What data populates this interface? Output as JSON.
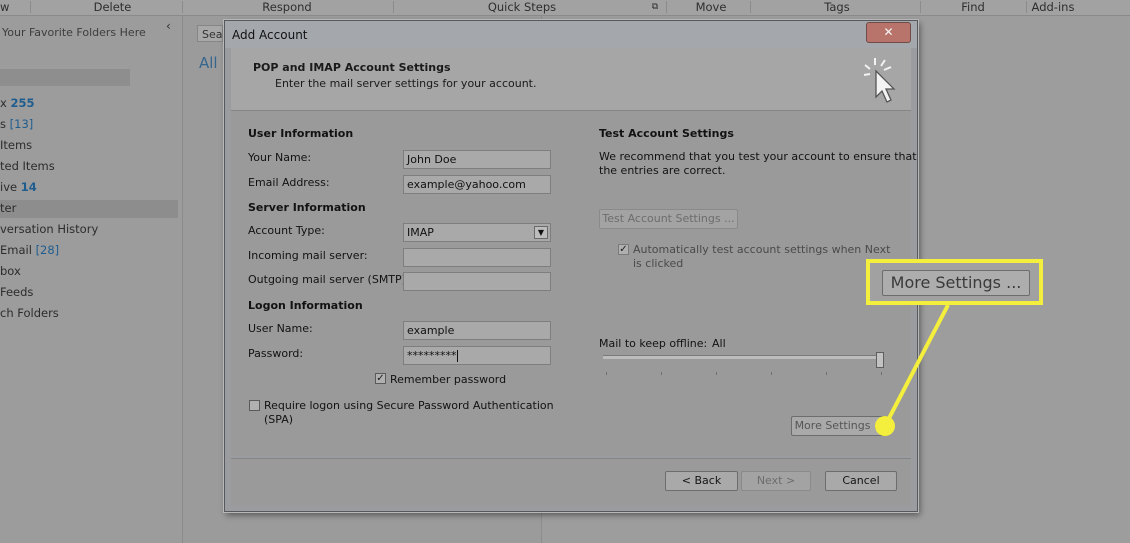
{
  "ribbon": {
    "groups": [
      "w",
      "Delete",
      "Respond",
      "Quick Steps",
      "Move",
      "Tags",
      "Find",
      "Add-ins"
    ]
  },
  "folders": {
    "favorites_hint": "Your Favorite Folders Here",
    "collapse_glyph": "‹",
    "items": [
      {
        "label": "x",
        "count": "255",
        "style": "bold"
      },
      {
        "label": "s",
        "count": "[13]",
        "style": "bracket"
      },
      {
        "label": "Items",
        "count": "",
        "style": ""
      },
      {
        "label": "ted Items",
        "count": "",
        "style": ""
      },
      {
        "label": "ive",
        "count": "14",
        "style": "bold"
      },
      {
        "label": "ter",
        "count": "",
        "style": "selected"
      },
      {
        "label": "versation History",
        "count": "",
        "style": ""
      },
      {
        "label": "Email",
        "count": "[28]",
        "style": "bracket"
      },
      {
        "label": "box",
        "count": "",
        "style": ""
      },
      {
        "label": "Feeds",
        "count": "",
        "style": ""
      },
      {
        "label": "ch Folders",
        "count": "",
        "style": ""
      }
    ]
  },
  "middle": {
    "search_placeholder": "Sea",
    "filter_all": "All"
  },
  "dialog": {
    "title": "Add Account",
    "close_glyph": "✕",
    "header_title": "POP and IMAP Account Settings",
    "header_subtitle": "Enter the mail server settings for your account.",
    "user_info_heading": "User Information",
    "your_name_label": "Your Name:",
    "your_name_value": "John Doe",
    "email_label": "Email Address:",
    "email_value": "example@yahoo.com",
    "server_info_heading": "Server Information",
    "account_type_label": "Account Type:",
    "account_type_value": "IMAP",
    "incoming_label": "Incoming mail server:",
    "incoming_value": "",
    "outgoing_label": "Outgoing mail server (SMTP):",
    "outgoing_value": "",
    "logon_info_heading": "Logon Information",
    "username_label": "User Name:",
    "username_value": "example",
    "password_label": "Password:",
    "password_value": "*********",
    "remember_label": "Remember password",
    "remember_checked": true,
    "spa_label_line1": "Require logon using Secure Password Authentication",
    "spa_label_line2": "(SPA)",
    "spa_checked": false,
    "test_heading": "Test Account Settings",
    "test_desc_line1": "We recommend that you test your account to ensure that",
    "test_desc_line2": "the entries are correct.",
    "test_button": "Test Account Settings ...",
    "auto_test_line1": "Automatically test account settings when Next",
    "auto_test_line2": "is clicked",
    "auto_test_checked": true,
    "offline_label": "Mail to keep offline:",
    "offline_value": "All",
    "offline_level": 1.0,
    "more_settings_button": "More Settings ...",
    "back_button": "< Back",
    "next_button": "Next >",
    "cancel_button": "Cancel"
  },
  "callout": {
    "label": "More Settings ...",
    "color": "#f4ee3c"
  }
}
